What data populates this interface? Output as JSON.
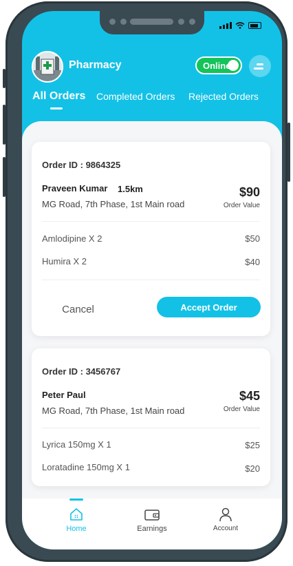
{
  "header": {
    "title": "Pharmacy",
    "status_toggle": "Online"
  },
  "tabs": [
    {
      "label": "All Orders",
      "active": true
    },
    {
      "label": "Completed Orders",
      "active": false
    },
    {
      "label": "Rejected Orders",
      "active": false
    }
  ],
  "orders": [
    {
      "order_id": "Order ID : 9864325",
      "customer": "Praveen Kumar",
      "distance": "1.5km",
      "address": "MG Road, 7th Phase, 1st Main road",
      "total": "$90",
      "total_label": "Order Value",
      "items": [
        {
          "name": "Amlodipine X 2",
          "price": "$50"
        },
        {
          "name": "Humira X 2",
          "price": "$40"
        }
      ],
      "cancel_label": "Cancel",
      "accept_label": "Accept Order"
    },
    {
      "order_id": "Order ID : 3456767",
      "customer": "Peter Paul",
      "address": "MG Road, 7th Phase, 1st Main road",
      "total": "$45",
      "total_label": "Order Value",
      "items": [
        {
          "name": "Lyrica 150mg X 1",
          "price": "$25"
        },
        {
          "name": "Loratadine 150mg X 1",
          "price": "$20"
        }
      ]
    }
  ],
  "bottom_nav": [
    {
      "label": "Home",
      "icon": "home-icon",
      "active": true
    },
    {
      "label": "Earnings",
      "icon": "wallet-icon",
      "active": false
    },
    {
      "label": "Account",
      "icon": "user-icon",
      "active": false
    }
  ],
  "colors": {
    "accent": "#13c1e6",
    "online": "#14c35a",
    "frame": "#3a4a52"
  }
}
